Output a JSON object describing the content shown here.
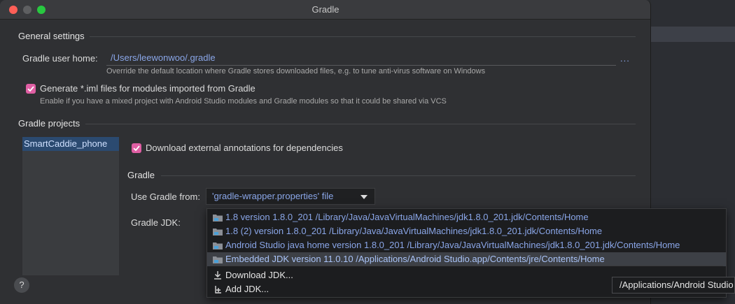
{
  "window": {
    "title": "Gradle"
  },
  "general": {
    "section_title": "General settings",
    "gradle_home_label": "Gradle user home:",
    "gradle_home_value": "/Users/leewonwoo/.gradle",
    "browse_label": "...",
    "gradle_home_hint": "Override the default location where Gradle stores downloaded files, e.g. to tune anti-virus software on Windows",
    "generate_iml_label": "Generate *.iml files for modules imported from Gradle",
    "generate_iml_checked": true,
    "generate_iml_hint": "Enable if you have a mixed project with Android Studio modules and Gradle modules so that it could be shared via VCS"
  },
  "projects": {
    "section_title": "Gradle projects",
    "items": [
      "SmartCaddie_phone"
    ],
    "download_annotations_label": "Download external annotations for dependencies",
    "download_annotations_checked": true,
    "gradle_group_title": "Gradle",
    "use_gradle_from_label": "Use Gradle from:",
    "use_gradle_from_value": "'gradle-wrapper.properties' file",
    "gradle_jdk_label": "Gradle JDK:"
  },
  "jdk_popup": {
    "options": [
      "1.8 version 1.8.0_201 /Library/Java/JavaVirtualMachines/jdk1.8.0_201.jdk/Contents/Home",
      "1.8 (2) version 1.8.0_201 /Library/Java/JavaVirtualMachines/jdk1.8.0_201.jdk/Contents/Home",
      "Android Studio java home version 1.8.0_201 /Library/Java/JavaVirtualMachines/jdk1.8.0_201.jdk/Contents/Home",
      "Embedded JDK version 11.0.10 /Applications/Android Studio.app/Contents/jre/Contents/Home"
    ],
    "selected_index": 3,
    "download_jdk_label": "Download JDK...",
    "add_jdk_label": "Add JDK..."
  },
  "tooltip": {
    "text": "/Applications/Android Studio"
  },
  "help": {
    "label": "?"
  },
  "colors": {
    "checkbox": "#e05fa4",
    "link_blue": "#8aa6e8",
    "selected_row": "#3d4046"
  }
}
